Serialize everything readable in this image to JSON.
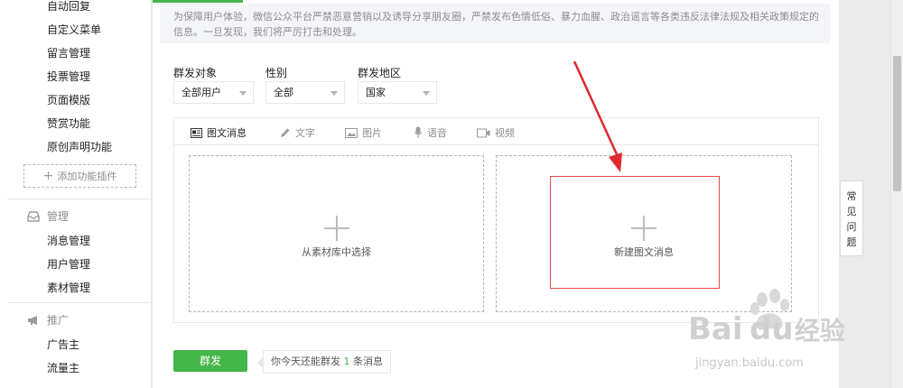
{
  "sidebar": {
    "items_top": [
      "自动回复",
      "自定义菜单",
      "留言管理",
      "投票管理",
      "页面模版",
      "赞赏功能",
      "原创声明功能"
    ],
    "add_plugin": "添加功能插件",
    "group_manage": {
      "title": "管理",
      "items": [
        "消息管理",
        "用户管理",
        "素材管理"
      ]
    },
    "group_promo": {
      "title": "推广",
      "items": [
        "广告主",
        "流量主"
      ]
    }
  },
  "notice": {
    "text": "为保障用户体验，微信公众平台严禁恶意营销以及诱导分享朋友圈，严禁发布色情低俗、暴力血腥、政治谣言等各类违反法律法规及相关政策规定的信息。一旦发现，我们将严厉打击和处理。"
  },
  "filters": {
    "target_label": "群发对象",
    "target_value": "全部用户",
    "gender_label": "性别",
    "gender_value": "全部",
    "region_label": "群发地区",
    "region_value": "国家"
  },
  "tabs": [
    "图文消息",
    "文字",
    "图片",
    "语音",
    "视频"
  ],
  "boxes": {
    "choose_label": "从素材库中选择",
    "new_label": "新建图文消息"
  },
  "send": {
    "button": "群发",
    "quota_prefix": "你今天还能群发",
    "quota_count": "1",
    "quota_suffix": "条消息"
  },
  "faq": [
    "常",
    "见",
    "问",
    "题"
  ],
  "watermark": {
    "brand": "Bai",
    "brand2": "du",
    "cn": "经验",
    "domain": "jingyan.baidu.com"
  },
  "colors": {
    "accent_green": "#44b549",
    "highlight_red": "#e8454d"
  }
}
